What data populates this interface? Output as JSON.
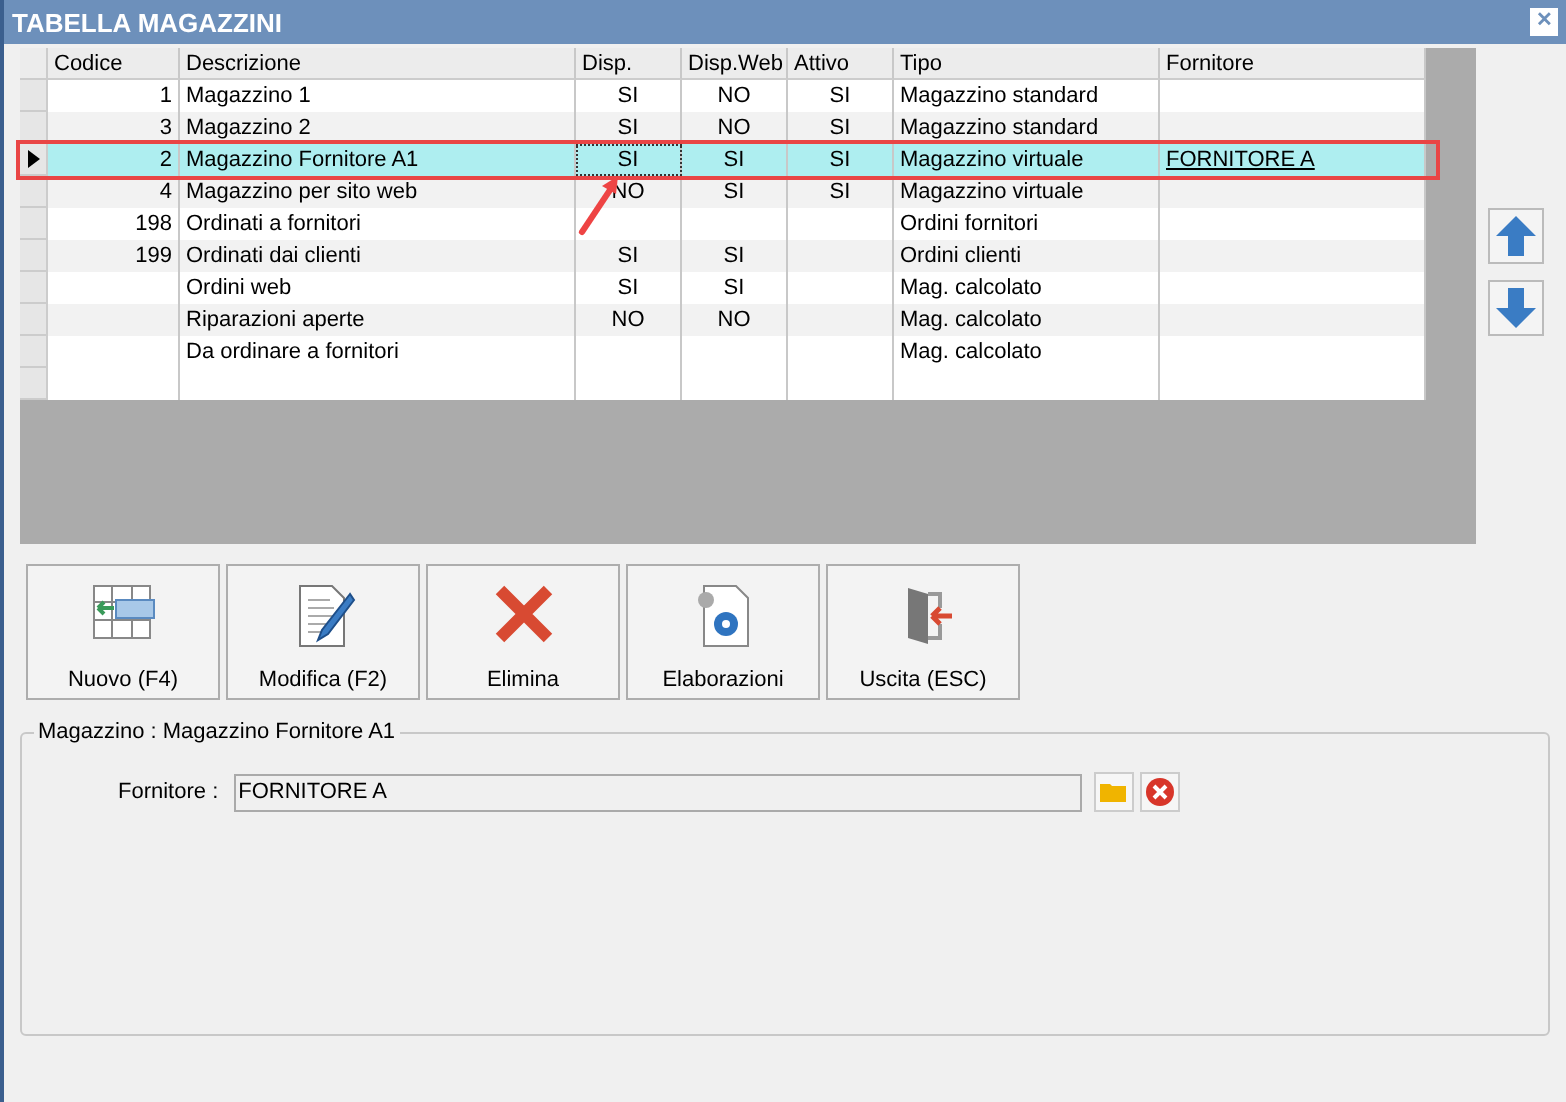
{
  "window": {
    "title": "TABELLA MAGAZZINI",
    "close": "✕"
  },
  "table": {
    "columns": [
      "Codice",
      "Descrizione",
      "Disp.",
      "Disp.Web",
      "Attivo",
      "Tipo",
      "Fornitore"
    ],
    "rows": [
      {
        "cells": [
          "1",
          "Magazzino 1",
          "SI",
          "NO",
          "SI",
          "Magazzino standard",
          ""
        ],
        "selected": false
      },
      {
        "cells": [
          "3",
          "Magazzino 2",
          "SI",
          "NO",
          "SI",
          "Magazzino standard",
          ""
        ],
        "selected": false
      },
      {
        "cells": [
          "2",
          "Magazzino Fornitore A1",
          "SI",
          "SI",
          "SI",
          "Magazzino virtuale",
          "FORNITORE A"
        ],
        "selected": true
      },
      {
        "cells": [
          "4",
          "Magazzino per sito web",
          "NO",
          "SI",
          "SI",
          "Magazzino virtuale",
          ""
        ],
        "selected": false
      },
      {
        "cells": [
          "198",
          "Ordinati a fornitori",
          "",
          "",
          "",
          "Ordini fornitori",
          ""
        ],
        "selected": false
      },
      {
        "cells": [
          "199",
          "Ordinati dai clienti",
          "SI",
          "SI",
          "",
          "Ordini clienti",
          ""
        ],
        "selected": false
      },
      {
        "cells": [
          "",
          "Ordini web",
          "SI",
          "SI",
          "",
          "Mag. calcolato",
          ""
        ],
        "selected": false
      },
      {
        "cells": [
          "",
          "Riparazioni aperte",
          "NO",
          "NO",
          "",
          "Mag. calcolato",
          ""
        ],
        "selected": false
      },
      {
        "cells": [
          "",
          "Da ordinare a fornitori",
          "",
          "",
          "",
          "Mag. calcolato",
          ""
        ],
        "selected": false
      }
    ]
  },
  "toolbar": [
    {
      "label": "Nuovo (F4)",
      "kind": "new"
    },
    {
      "label": "Modifica (F2)",
      "kind": "edit"
    },
    {
      "label": "Elimina",
      "kind": "delete"
    },
    {
      "label": "Elaborazioni",
      "kind": "process"
    },
    {
      "label": "Uscita (ESC)",
      "kind": "exit"
    }
  ],
  "detail": {
    "title": "Magazzino : Magazzino Fornitore A1",
    "field_label": "Fornitore :",
    "field_value": "FORNITORE A"
  }
}
